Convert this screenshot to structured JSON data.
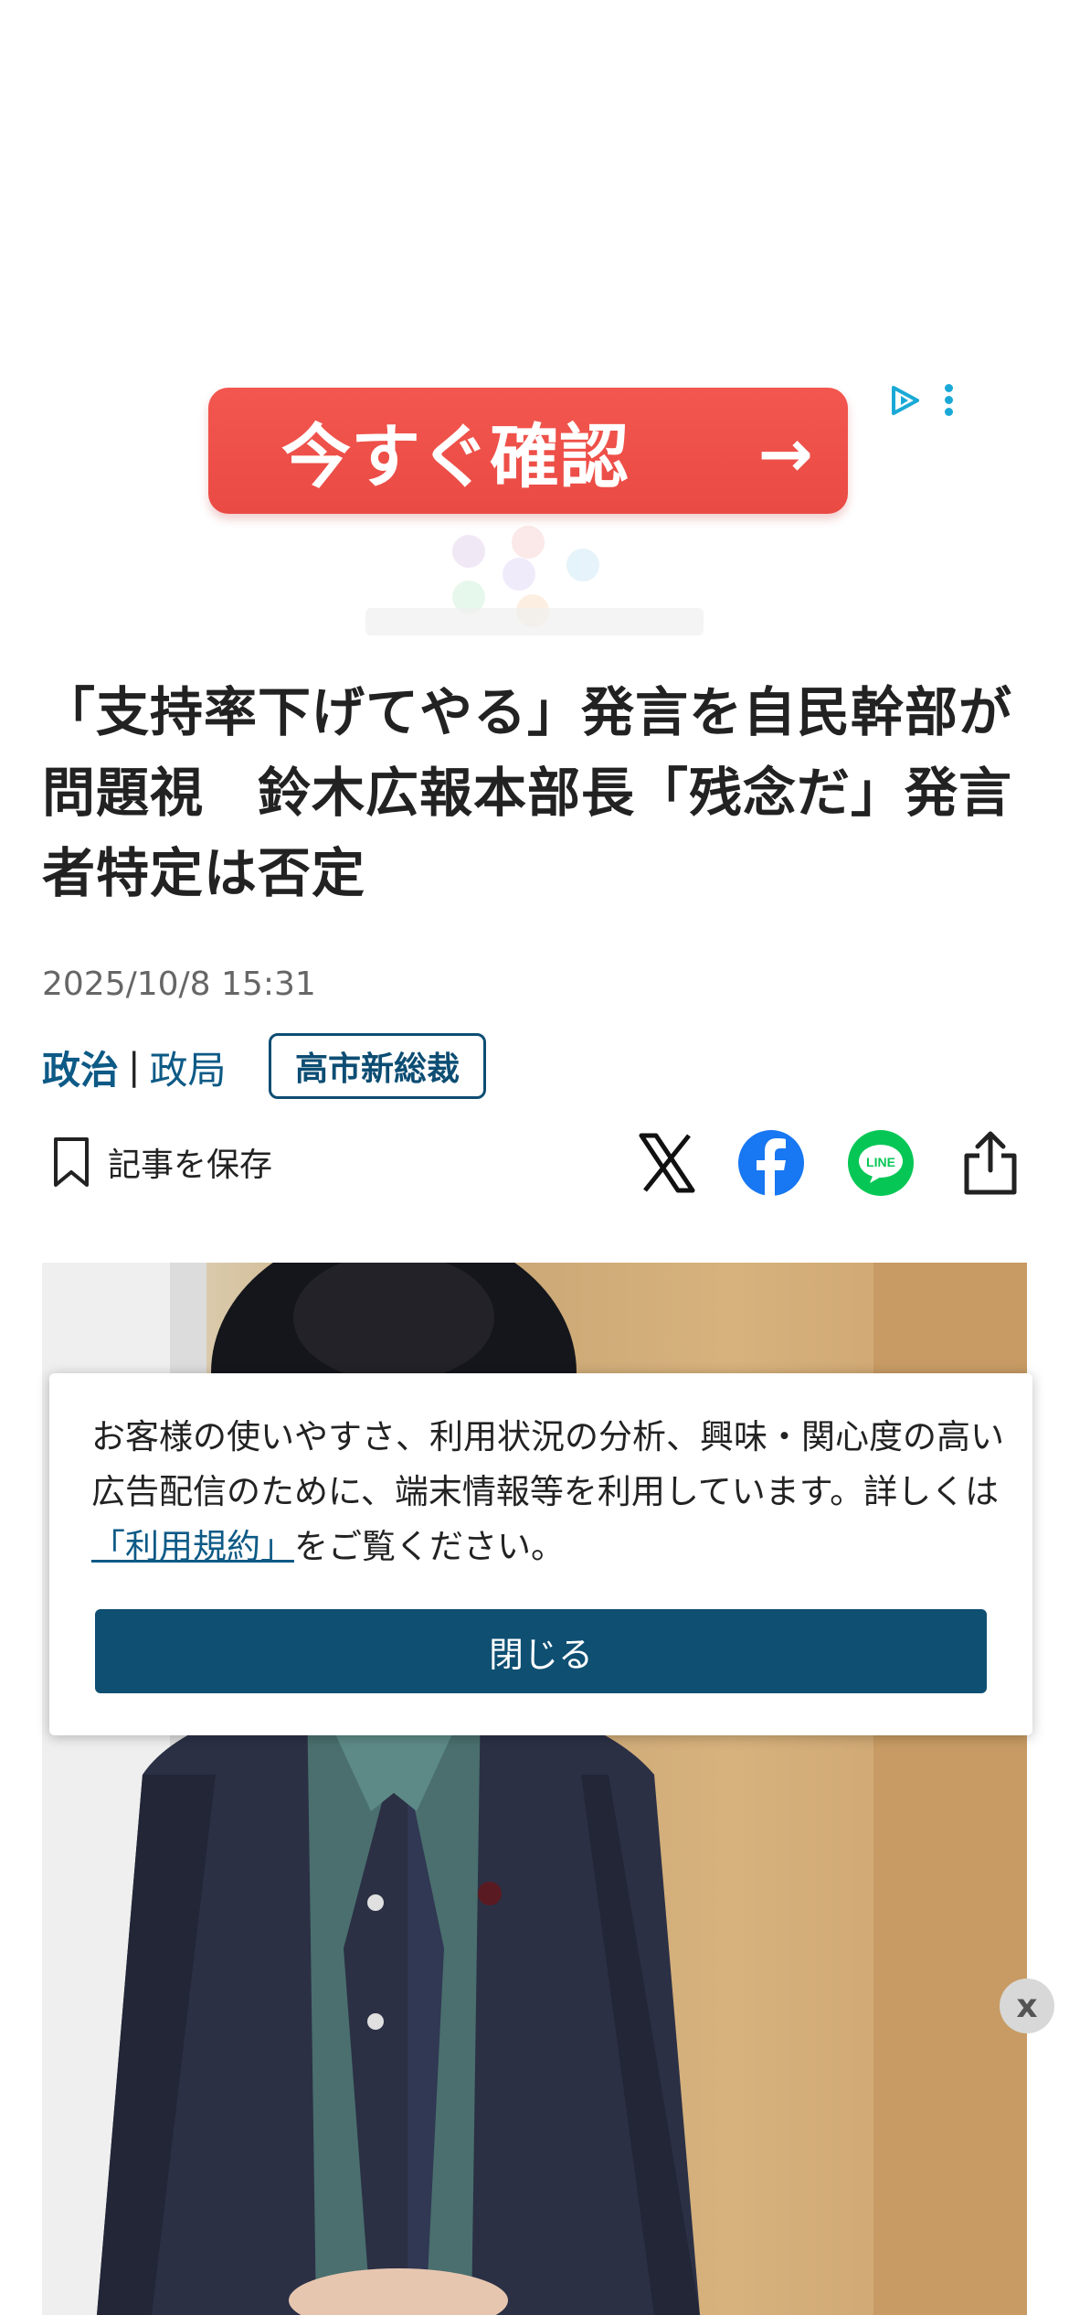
{
  "ad": {
    "cta_label": "今すぐ確認",
    "cta_arrow": "→",
    "choices_icon": "adchoices-icon",
    "menu_icon": "kebab-menu-icon"
  },
  "article": {
    "headline": "「支持率下げてやる」発言を自民幹部が問題視　鈴木広報本部長「残念だ」発言者特定は否定",
    "datetime": "2025/10/8 15:31",
    "category_main": "政治",
    "category_sep": "|",
    "category_sub": "政局",
    "tag": "高市新総裁",
    "save_label": "記事を保存"
  },
  "share": {
    "icons": [
      "x-icon",
      "facebook-icon",
      "line-icon",
      "share-icon"
    ],
    "colors": {
      "facebook": "#1877f2",
      "line": "#06c755"
    }
  },
  "notice": {
    "text_before": "お客様の使いやすさ、利用状況の分析、興味・関心度の高い広告配信のために、端末情報等を利用しています。詳しくは",
    "link_text": "「利用規約」",
    "text_after": "をご覧ください。",
    "close_label": "閉じる"
  },
  "float_close_label": "x",
  "colors": {
    "accent": "#0d5a86",
    "button": "#0e4f72",
    "ad_red": "#ef5350"
  }
}
